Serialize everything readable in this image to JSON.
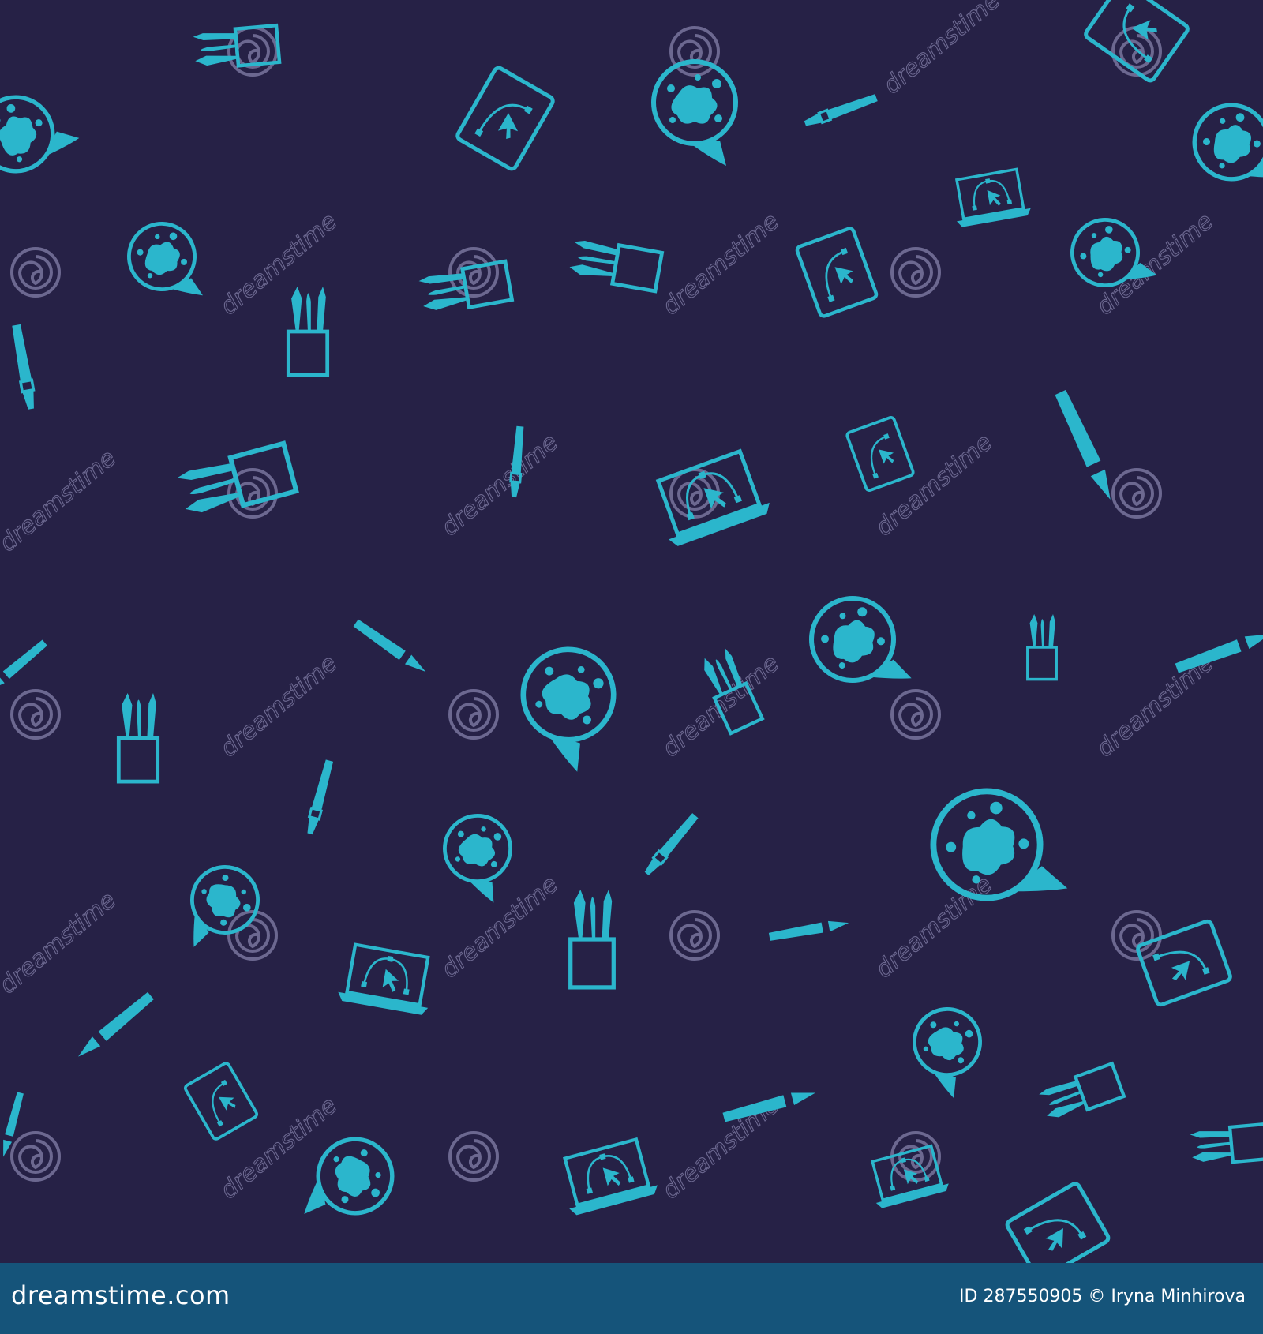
{
  "image": {
    "description_colors": {
      "background": "#262146",
      "icon": "#2bb6cc",
      "watermark": "#6c6890",
      "footer": "#15547a"
    },
    "icon_types": [
      "speech-bubble-paint-splash-icon",
      "laptop-vector-editor-icon",
      "tablet-vector-editor-icon",
      "paintbrush-cup-icon",
      "paintbrush-icon",
      "art-knife-icon"
    ]
  },
  "watermark": {
    "text": "dreamstime"
  },
  "footer": {
    "logo_text": "dreamstime.com",
    "credit_text": "ID 287550905 © Iryna Minhirova"
  }
}
